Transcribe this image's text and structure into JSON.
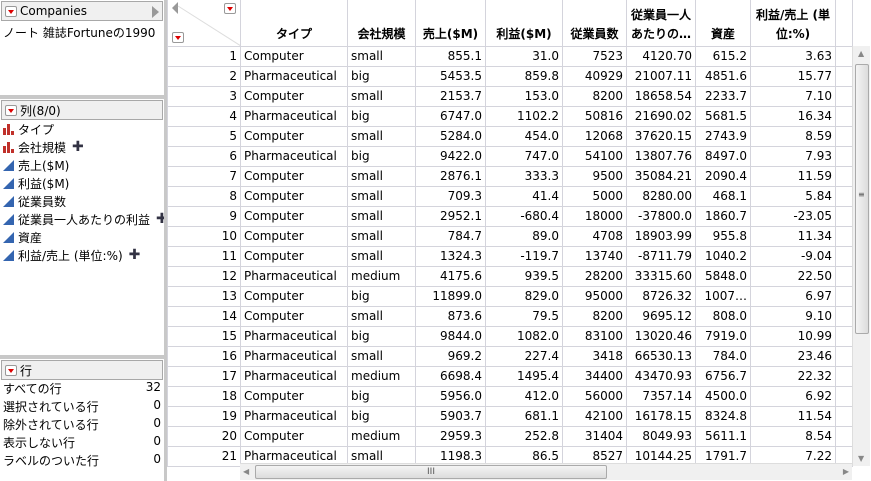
{
  "table_panel": {
    "title": "Companies",
    "note": "ノート  雑誌Fortuneの1990"
  },
  "columns_panel": {
    "title": "列(8/0)",
    "items": [
      {
        "label": "タイプ",
        "type": "nominal",
        "has_plus": false
      },
      {
        "label": "会社規模",
        "type": "nominal",
        "has_plus": true
      },
      {
        "label": "売上($M)",
        "type": "continuous",
        "has_plus": false
      },
      {
        "label": "利益($M)",
        "type": "continuous",
        "has_plus": false
      },
      {
        "label": "従業員数",
        "type": "continuous",
        "has_plus": false
      },
      {
        "label": "従業員一人あたりの利益",
        "type": "continuous",
        "has_plus": true
      },
      {
        "label": "資産",
        "type": "continuous",
        "has_plus": false
      },
      {
        "label": "利益/売上 (単位:%)",
        "type": "continuous",
        "has_plus": true
      }
    ]
  },
  "rows_panel": {
    "title": "行",
    "items": [
      {
        "label": "すべての行",
        "value": "32"
      },
      {
        "label": "選択されている行",
        "value": "0"
      },
      {
        "label": "除外されている行",
        "value": "0"
      },
      {
        "label": "表示しない行",
        "value": "0"
      },
      {
        "label": "ラベルのついた行",
        "value": "0"
      }
    ]
  },
  "table": {
    "headers": [
      "タイプ",
      "会社規模",
      "売上($M)",
      "利益($M)",
      "従業員数",
      "従業員一人あたりの…",
      "資産",
      "利益/売上 (単位:%)"
    ],
    "rows": [
      [
        "1",
        "Computer",
        "small",
        "855.1",
        "31.0",
        "7523",
        "4120.70",
        "615.2",
        "3.63"
      ],
      [
        "2",
        "Pharmaceutical",
        "big",
        "5453.5",
        "859.8",
        "40929",
        "21007.11",
        "4851.6",
        "15.77"
      ],
      [
        "3",
        "Computer",
        "small",
        "2153.7",
        "153.0",
        "8200",
        "18658.54",
        "2233.7",
        "7.10"
      ],
      [
        "4",
        "Pharmaceutical",
        "big",
        "6747.0",
        "1102.2",
        "50816",
        "21690.02",
        "5681.5",
        "16.34"
      ],
      [
        "5",
        "Computer",
        "small",
        "5284.0",
        "454.0",
        "12068",
        "37620.15",
        "2743.9",
        "8.59"
      ],
      [
        "6",
        "Pharmaceutical",
        "big",
        "9422.0",
        "747.0",
        "54100",
        "13807.76",
        "8497.0",
        "7.93"
      ],
      [
        "7",
        "Computer",
        "small",
        "2876.1",
        "333.3",
        "9500",
        "35084.21",
        "2090.4",
        "11.59"
      ],
      [
        "8",
        "Computer",
        "small",
        "709.3",
        "41.4",
        "5000",
        "8280.00",
        "468.1",
        "5.84"
      ],
      [
        "9",
        "Computer",
        "small",
        "2952.1",
        "-680.4",
        "18000",
        "-37800.0",
        "1860.7",
        "-23.05"
      ],
      [
        "10",
        "Computer",
        "small",
        "784.7",
        "89.0",
        "4708",
        "18903.99",
        "955.8",
        "11.34"
      ],
      [
        "11",
        "Computer",
        "small",
        "1324.3",
        "-119.7",
        "13740",
        "-8711.79",
        "1040.2",
        "-9.04"
      ],
      [
        "12",
        "Pharmaceutical",
        "medium",
        "4175.6",
        "939.5",
        "28200",
        "33315.60",
        "5848.0",
        "22.50"
      ],
      [
        "13",
        "Computer",
        "big",
        "11899.0",
        "829.0",
        "95000",
        "8726.32",
        "1007…",
        "6.97"
      ],
      [
        "14",
        "Computer",
        "small",
        "873.6",
        "79.5",
        "8200",
        "9695.12",
        "808.0",
        "9.10"
      ],
      [
        "15",
        "Pharmaceutical",
        "big",
        "9844.0",
        "1082.0",
        "83100",
        "13020.46",
        "7919.0",
        "10.99"
      ],
      [
        "16",
        "Pharmaceutical",
        "small",
        "969.2",
        "227.4",
        "3418",
        "66530.13",
        "784.0",
        "23.46"
      ],
      [
        "17",
        "Pharmaceutical",
        "medium",
        "6698.4",
        "1495.4",
        "34400",
        "43470.93",
        "6756.7",
        "22.32"
      ],
      [
        "18",
        "Computer",
        "big",
        "5956.0",
        "412.0",
        "56000",
        "7357.14",
        "4500.0",
        "6.92"
      ],
      [
        "19",
        "Pharmaceutical",
        "big",
        "5903.7",
        "681.1",
        "42100",
        "16178.15",
        "8324.8",
        "11.54"
      ],
      [
        "20",
        "Computer",
        "medium",
        "2959.3",
        "252.8",
        "31404",
        "8049.93",
        "5611.1",
        "8.54"
      ],
      [
        "21",
        "Pharmaceutical",
        "small",
        "1198.3",
        "86.5",
        "8527",
        "10144.25",
        "1791.7",
        "7.22"
      ]
    ]
  }
}
